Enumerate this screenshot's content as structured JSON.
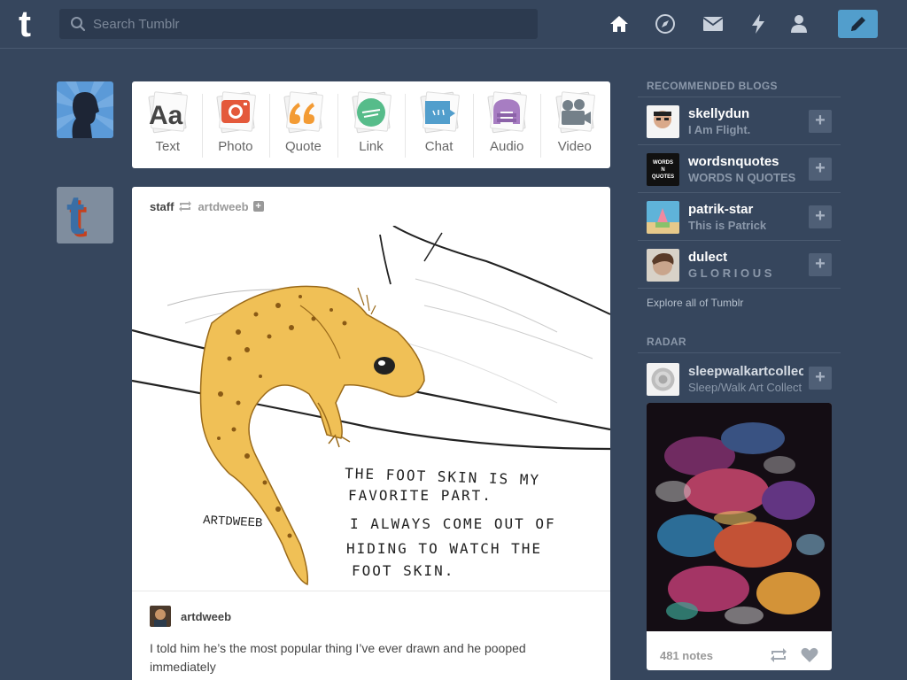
{
  "header": {
    "logo": "t",
    "search_placeholder": "Search Tumblr",
    "icons": [
      "home-icon",
      "explore-icon",
      "inbox-icon",
      "activity-icon",
      "account-icon",
      "compose-icon"
    ]
  },
  "post_types": [
    {
      "label": "Text",
      "glyph": "Aa"
    },
    {
      "label": "Photo"
    },
    {
      "label": "Quote",
      "glyph": "““"
    },
    {
      "label": "Link"
    },
    {
      "label": "Chat"
    },
    {
      "label": "Audio"
    },
    {
      "label": "Video"
    }
  ],
  "post": {
    "author": "staff",
    "reblogged_from": "artdweeb",
    "artwork": {
      "signature": "ARTDWEEB",
      "lines": [
        "THE FOOT SKIN IS MY",
        "FAVORITE PART.",
        "I ALWAYS COME OUT OF",
        "HIDING TO WATCH THE",
        "FOOT SKIN."
      ]
    },
    "source_blog": "artdweeb",
    "caption": "I told him he’s the most popular thing I’ve ever drawn and he pooped immediately"
  },
  "sidebar": {
    "recommended_title": "RECOMMENDED BLOGS",
    "blogs": [
      {
        "name": "skellydun",
        "subtitle": "I Am Flight."
      },
      {
        "name": "wordsnquotes",
        "subtitle": "WORDS N QUOTES",
        "avatar_text": "WORDS N QUOTES"
      },
      {
        "name": "patrik-star",
        "subtitle": "This is Patrick"
      },
      {
        "name": "dulect",
        "subtitle": "G L O R I O U S"
      }
    ],
    "explore_link": "Explore all of Tumblr",
    "radar_title": "RADAR",
    "radar": {
      "name": "sleepwalkartcollect",
      "subtitle": "Sleep/Walk Art Collect",
      "notes": "481 notes"
    }
  },
  "colors": {
    "background": "#36465d",
    "accent": "#529ecc"
  }
}
